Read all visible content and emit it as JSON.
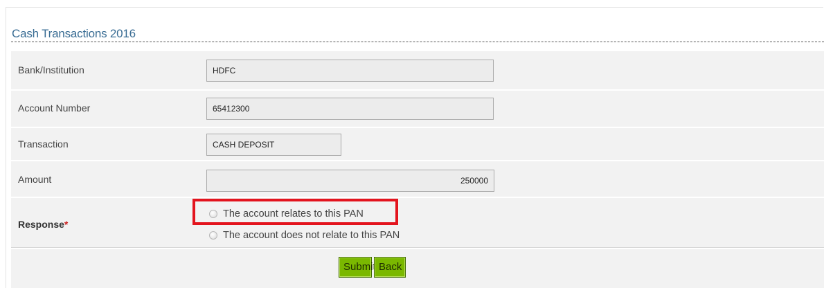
{
  "section": {
    "title": "Cash Transactions 2016"
  },
  "rows": [
    {
      "label": "Bank/Institution",
      "value": "HDFC"
    },
    {
      "label": "Account Number",
      "value": "65412300"
    },
    {
      "label": "Transaction",
      "value": "CASH DEPOSIT"
    },
    {
      "label": "Amount",
      "value": "250000"
    }
  ],
  "response": {
    "label": "Response",
    "required_mark": "*",
    "options": [
      {
        "label": "The account relates to this PAN",
        "selected": false,
        "highlighted": true
      },
      {
        "label": "The account does not relate to this PAN",
        "selected": false,
        "highlighted": false
      }
    ],
    "highlight_color": "#e3141e"
  },
  "actions": {
    "submit_label": "Submit",
    "back_label": "Back"
  },
  "colors": {
    "title": "#3a6d94",
    "button": "#7ab800",
    "row_background": "#f2f2f2"
  }
}
